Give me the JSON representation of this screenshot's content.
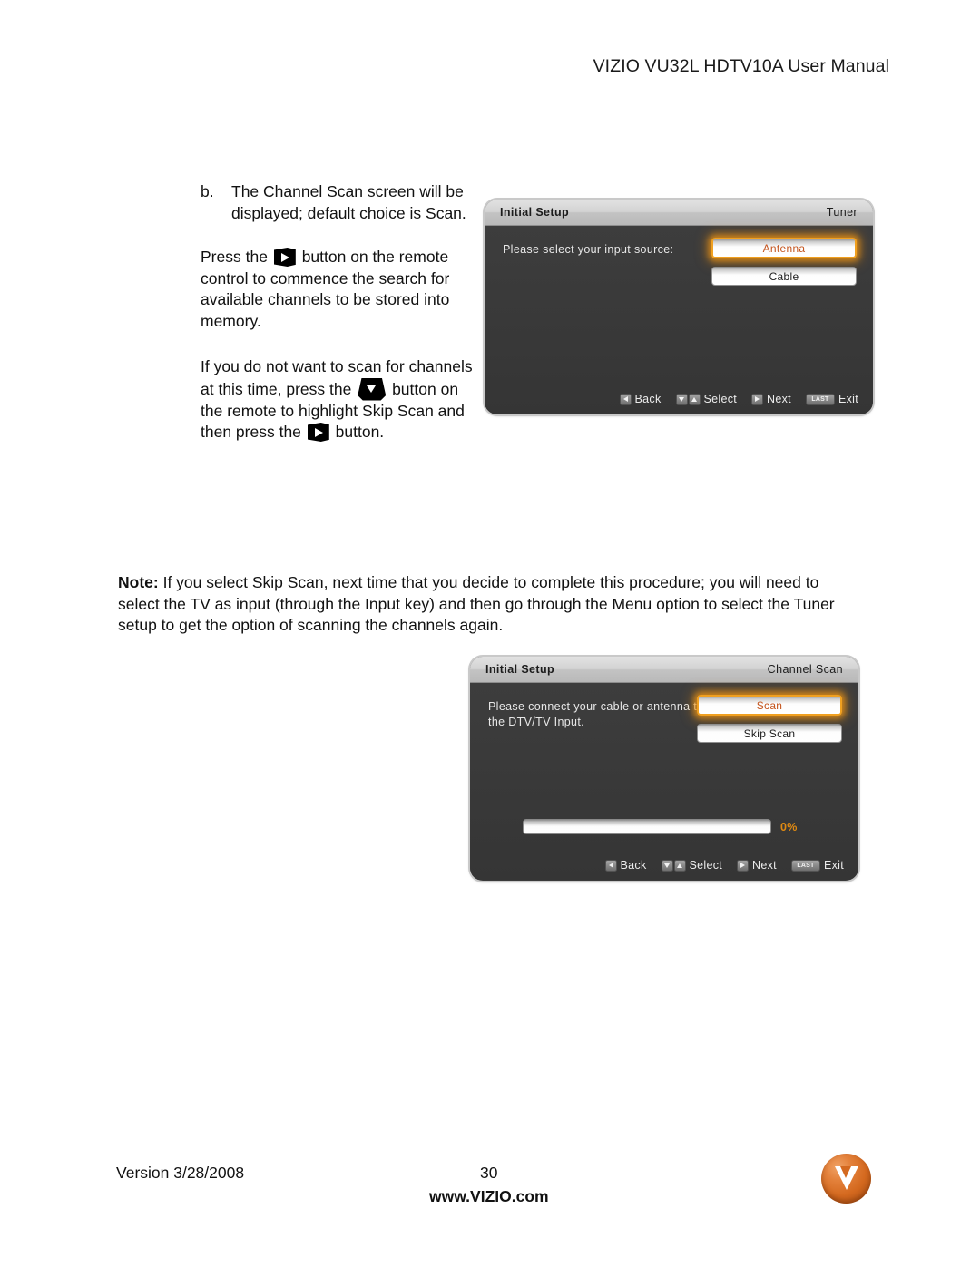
{
  "page_header": "VIZIO VU32L HDTV10A User Manual",
  "instructions": {
    "step_marker": "b.",
    "step_text": "The Channel Scan screen will be displayed; default choice is Scan.",
    "paragraph2_part1": "Press the",
    "paragraph2_part2": "button on the remote control to commence the search for available channels to be stored into memory.",
    "paragraph3_part1": "If you do not want to scan for channels at this time, press the",
    "paragraph3_part2": "button on the remote to highlight Skip Scan and then press the",
    "paragraph3_part3": "button."
  },
  "note": {
    "label": "Note:",
    "text": " If you select Skip Scan, next time that you decide to complete this procedure; you will need to select the TV as input (through the Input key) and then go through the Menu option to select the Tuner setup to get the option of scanning the channels again."
  },
  "osd_tuner": {
    "title": "Initial Setup",
    "section": "Tuner",
    "prompt": "Please select your input source:",
    "options": [
      {
        "label": "Antenna",
        "selected": true
      },
      {
        "label": "Cable",
        "selected": false
      }
    ],
    "nav": [
      {
        "label": "Back",
        "key": "left"
      },
      {
        "label": "Select",
        "key": "updown"
      },
      {
        "label": "Next",
        "key": "right"
      },
      {
        "label": "Exit",
        "key": "last",
        "key_text": "LAST"
      }
    ]
  },
  "osd_channel_scan": {
    "title": "Initial Setup",
    "section": "Channel Scan",
    "prompt": "Please connect your cable or antenna to the DTV/TV Input.",
    "options": [
      {
        "label": "Scan",
        "selected": true
      },
      {
        "label": "Skip Scan",
        "selected": false
      }
    ],
    "progress_label": "0%",
    "progress_value": 0,
    "nav": [
      {
        "label": "Back",
        "key": "left"
      },
      {
        "label": "Select",
        "key": "updown"
      },
      {
        "label": "Next",
        "key": "right"
      },
      {
        "label": "Exit",
        "key": "last",
        "key_text": "LAST"
      }
    ]
  },
  "footer": {
    "version": "Version 3/28/2008",
    "page_number": "30",
    "website": "www.VIZIO.com"
  },
  "colors": {
    "accent_orange": "#d4691f",
    "highlight_glow": "#f0a020",
    "osd_background": "#3a3a3a",
    "osd_titlebar": "#d3d3d3"
  }
}
